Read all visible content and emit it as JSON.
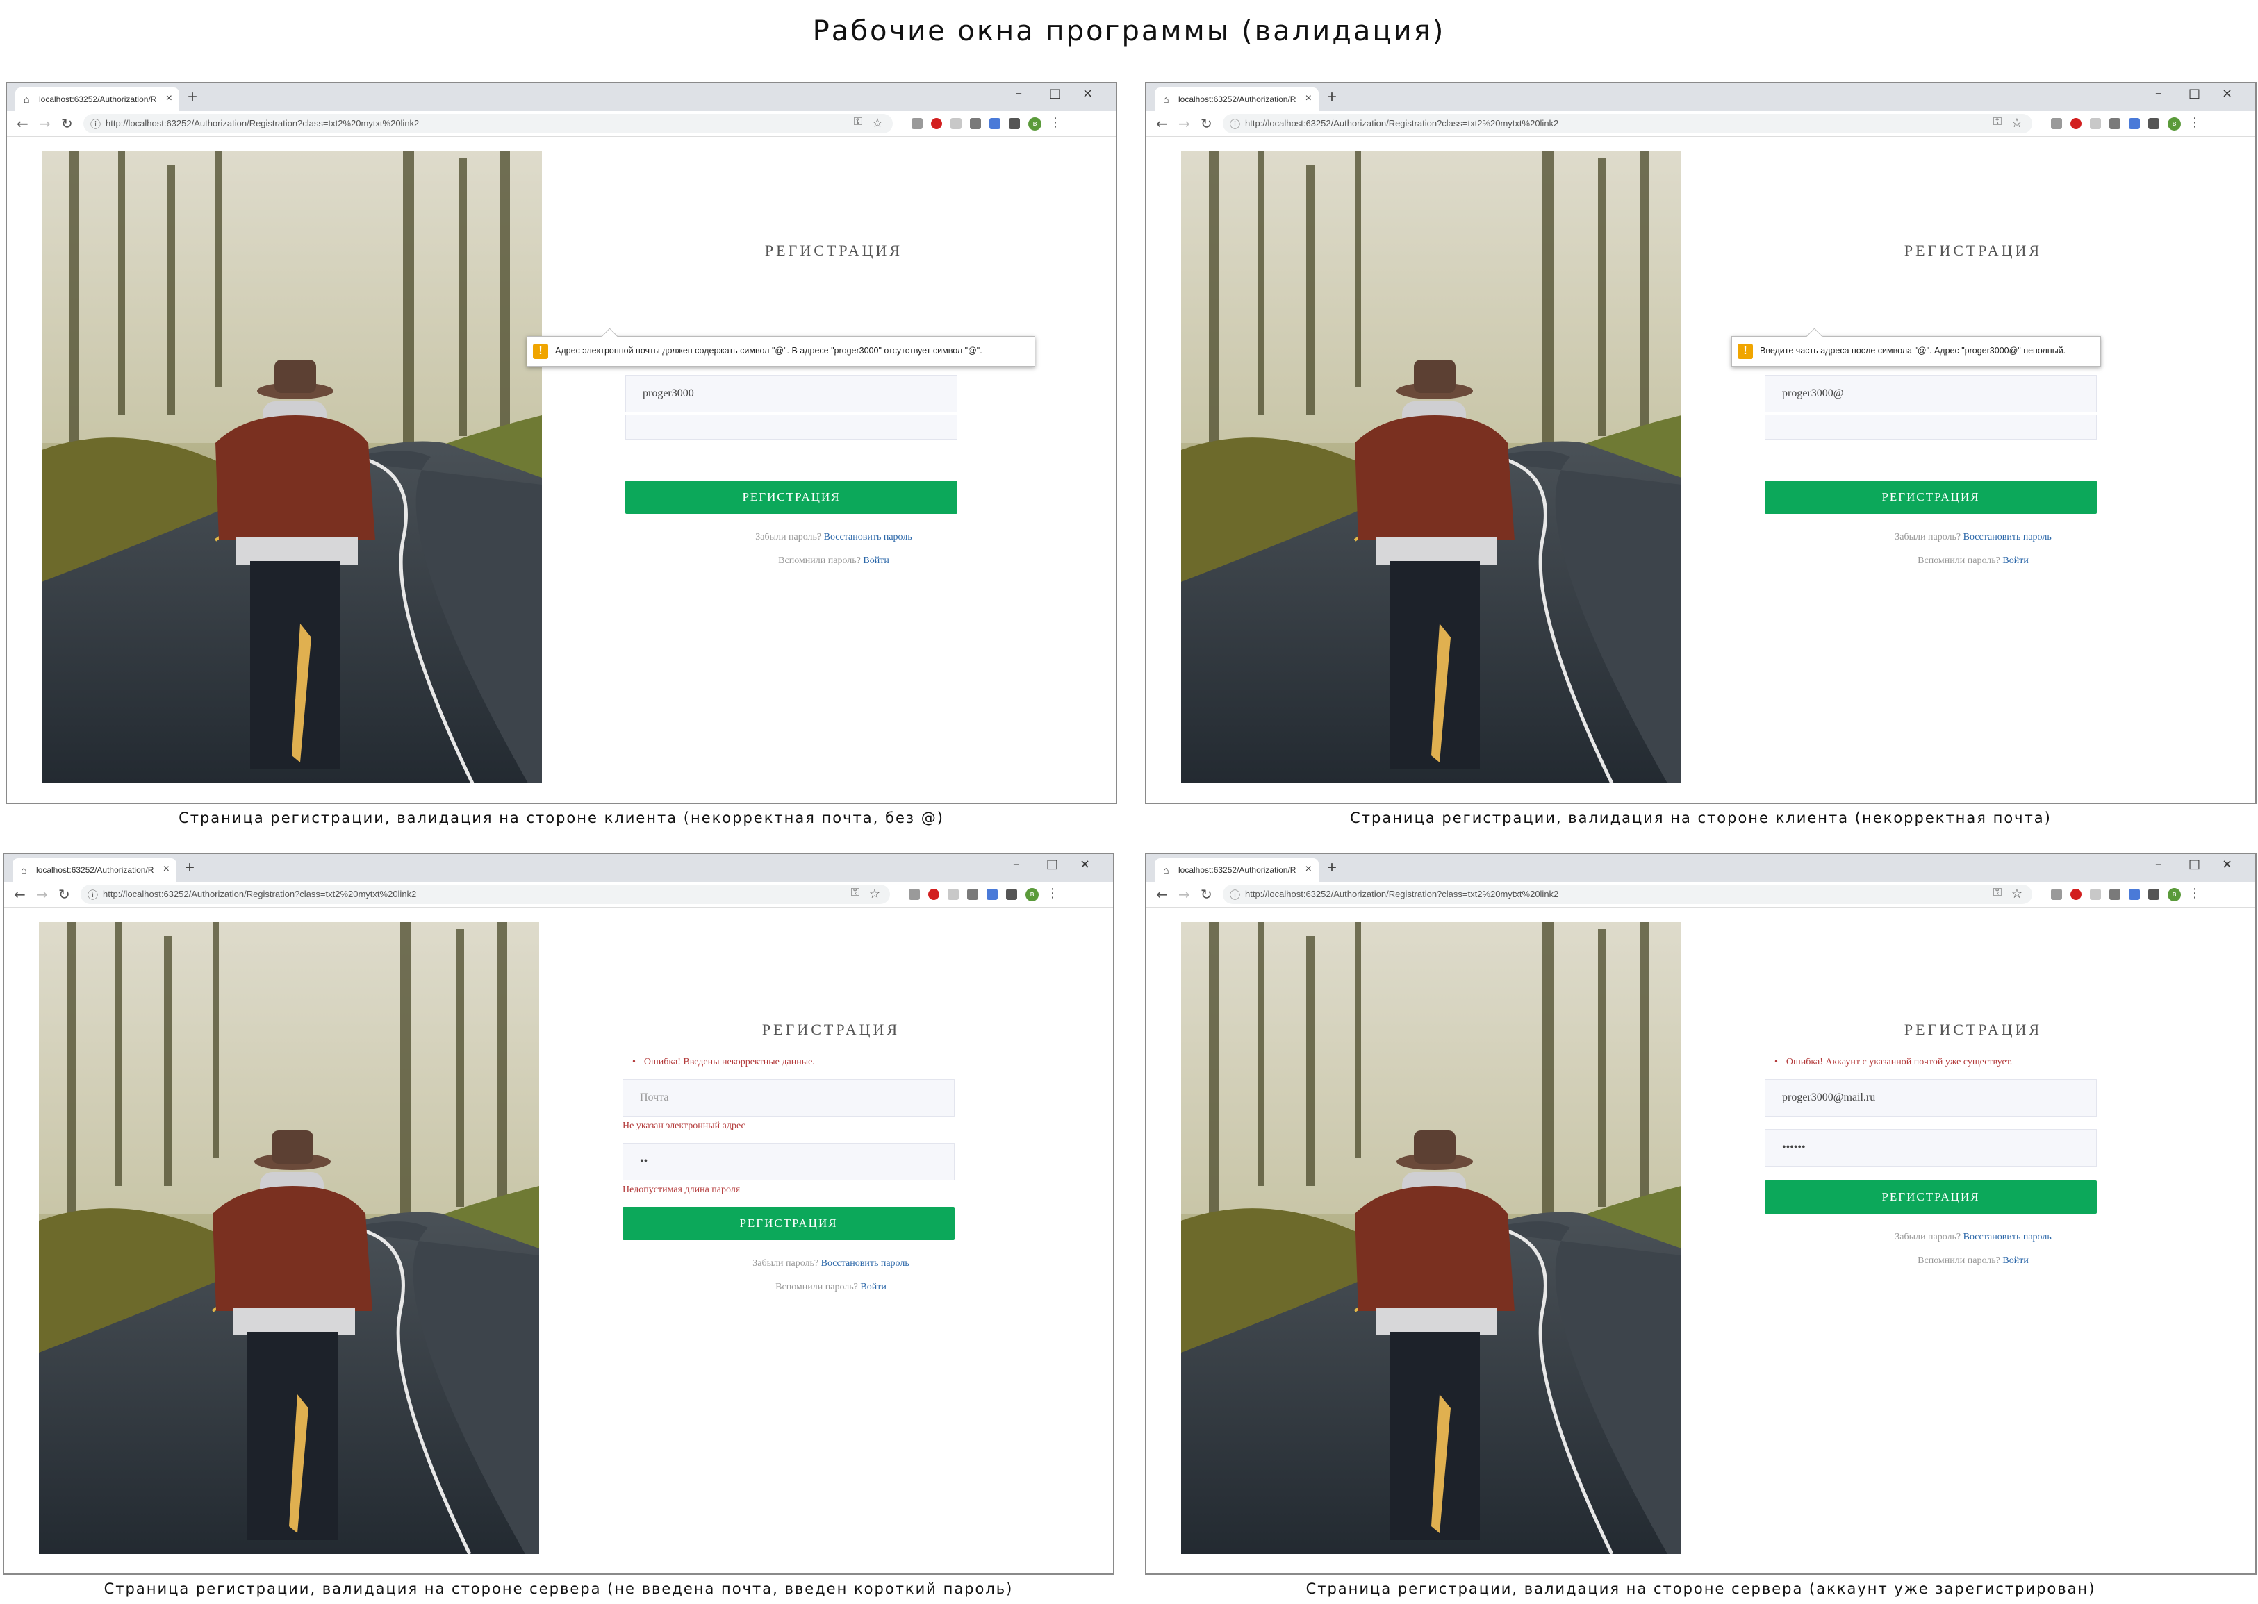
{
  "sheet_title": "Рабочие окна программы (валидация)",
  "browser": {
    "tab_title": "localhost:63252/Authorization/R",
    "tab_icon": "home-icon",
    "url": "http://localhost:63252/Authorization/Registration?class=txt2%20mytxt%20link2",
    "window_controls": [
      "minimize-icon",
      "maximize-icon",
      "close-icon"
    ]
  },
  "form": {
    "title": "РЕГИСТРАЦИЯ",
    "button_label": "РЕГИСТРАЦИЯ",
    "forgot_prefix": "Забыли пароль?",
    "forgot_link": "Восстановить пароль",
    "remember_prefix": "Вспомнили пароль?",
    "remember_link": "Войти",
    "email_placeholder": "Почта"
  },
  "colors": {
    "button": "#0ca85a",
    "error_text": "#b33a3a",
    "link": "#2a66a8",
    "warning": "#f0a500"
  },
  "panels": [
    {
      "caption": "Страница регистрации, валидация на стороне клиента (некорректная почта, без @)",
      "email_value": "proger3000",
      "tooltip": "Адрес электронной почты должен содержать символ \"@\". В адресе \"proger3000\" отсутствует символ \"@\"."
    },
    {
      "caption": "Страница регистрации, валидация на стороне клиента (некорректная почта)",
      "email_value": "proger3000@",
      "tooltip": "Введите часть адреса после символа \"@\". Адрес \"proger3000@\" неполный."
    },
    {
      "caption": "Страница регистрации, валидация на стороне сервера (не введена почта, введен короткий пароль)",
      "summary_error": "Ошибка! Введены некорректные данные.",
      "password_value": "••",
      "email_error": "Не указан электронный адрес",
      "password_error": "Недопустимая длина пароля"
    },
    {
      "caption": "Страница регистрации, валидация на стороне сервера (аккаунт уже зарегистрирован)",
      "summary_error": "Ошибка! Аккаунт с указанной почтой уже существует.",
      "email_value": "proger3000@mail.ru",
      "password_value": "••••••"
    }
  ]
}
